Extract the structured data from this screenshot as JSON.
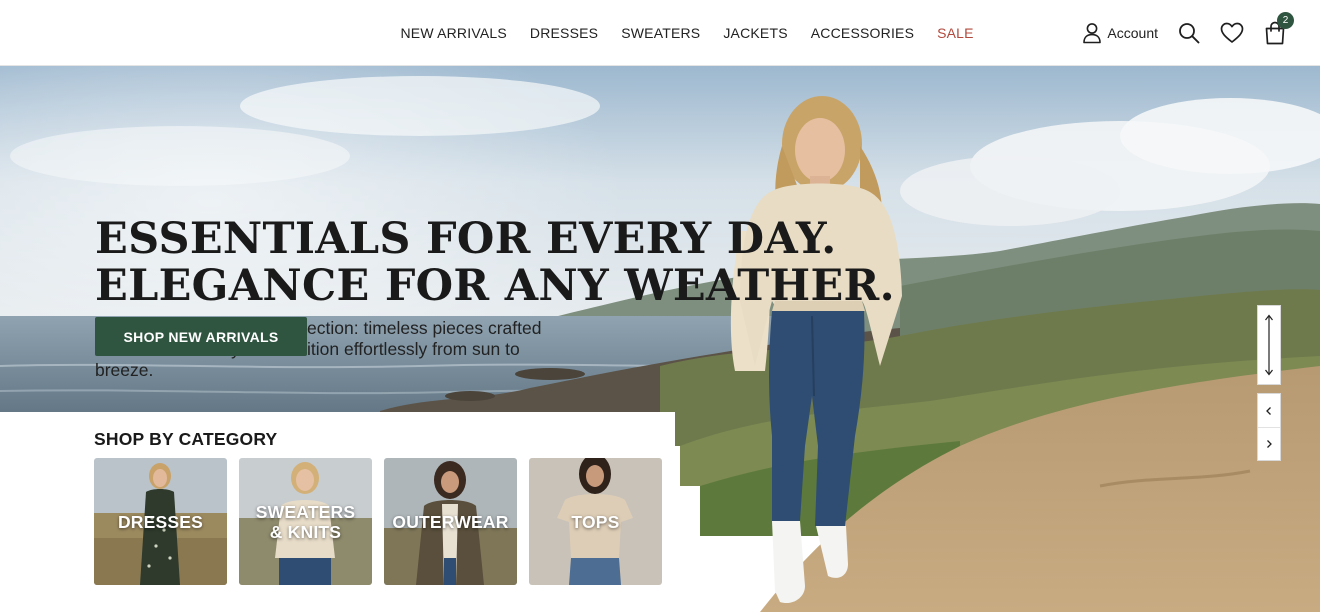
{
  "header": {
    "nav": [
      {
        "label": "NEW ARRIVALS"
      },
      {
        "label": "DRESSES"
      },
      {
        "label": "SWEATERS"
      },
      {
        "label": "JACKETS"
      },
      {
        "label": "ACCESSORIES"
      },
      {
        "label": "SALE",
        "highlight_color": "#b2493d"
      }
    ],
    "account_label": "Account",
    "icons": [
      "user-icon",
      "search-icon",
      "heart-icon",
      "shopping-bag-icon"
    ],
    "bag_count": "2"
  },
  "hero": {
    "headline_line1": "ESSENTIALS FOR EVERY DAY.",
    "headline_line2": "ELEGANCE FOR ANY WEATHER.",
    "subtext": "Discover the Signature Collection: timeless pieces crafted for comfort and style. Transition effortlessly from sun to breeze.",
    "cta_label": "SHOP NEW ARRIVALS"
  },
  "categories": {
    "title": "SHOP BY CATEGORY",
    "items": [
      {
        "label": "DRESSES"
      },
      {
        "label": "SWEATERS\n& KNITS"
      },
      {
        "label": "OUTERWEAR"
      },
      {
        "label": "TOPS"
      }
    ]
  },
  "colors": {
    "brand_green": "#2f5540",
    "sale_red": "#b2493d",
    "text": "#1d1d1d"
  }
}
